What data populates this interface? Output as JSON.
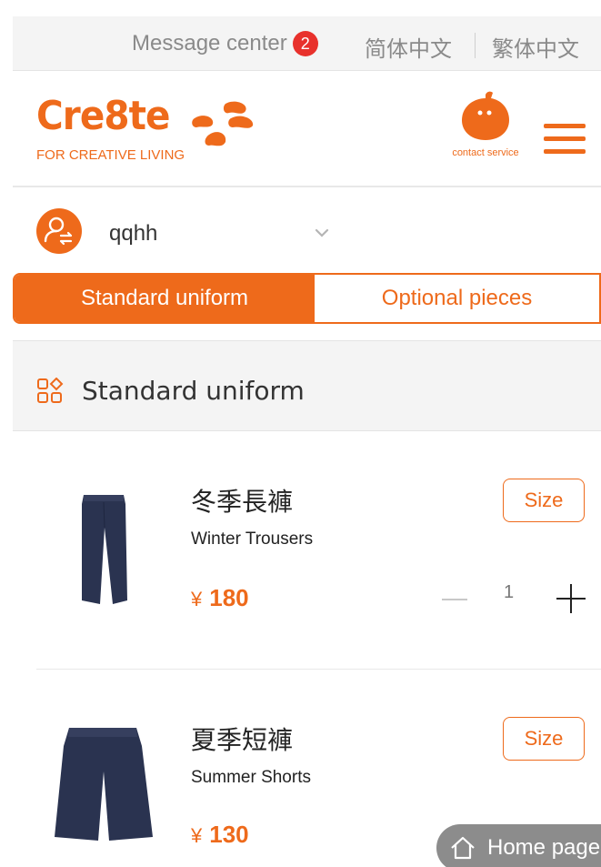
{
  "topbar": {
    "message_center_label": "Message center",
    "message_count": "2",
    "lang_simplified": "简体中文",
    "lang_traditional": "繁体中文"
  },
  "header": {
    "logo_text": "Cre8te",
    "logo_tagline": "FOR CREATIVE LIVING",
    "contact_label": "contact service",
    "icons": {
      "logo": "cre8te-logo-mark",
      "contact": "contact-face-icon",
      "menu": "hamburger-menu-icon"
    }
  },
  "user": {
    "name": "qqhh",
    "icons": {
      "avatar": "user-switch-icon",
      "dropdown": "chevron-down-icon"
    }
  },
  "tabs": {
    "active": "Standard uniform",
    "inactive": "Optional pieces"
  },
  "section": {
    "title": "Standard uniform",
    "icon": "category-grid-icon"
  },
  "products": [
    {
      "name_zh": "冬季長褲",
      "name_en": "Winter Trousers",
      "currency": "¥",
      "price": "180",
      "size_label": "Size",
      "quantity": "1"
    },
    {
      "name_zh": "夏季短褲",
      "name_en": "Summer Shorts",
      "currency": "¥",
      "price": "130",
      "size_label": "Size"
    }
  ],
  "home_button": {
    "label": "Home page",
    "icon": "home-icon"
  },
  "colors": {
    "accent": "#ee6a1b",
    "badge": "#e8312c",
    "product_navy": "#2a3350"
  }
}
